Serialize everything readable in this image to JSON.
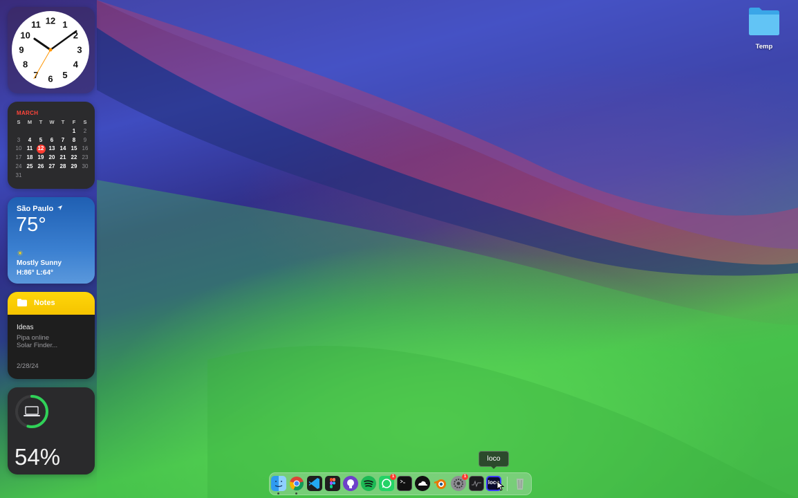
{
  "clock": {
    "numbers": [
      "12",
      "1",
      "2",
      "3",
      "4",
      "5",
      "6",
      "7",
      "8",
      "9",
      "10",
      "11"
    ],
    "hour": 10,
    "minute": 9,
    "second": 35,
    "second_hand_color": "#ff9500"
  },
  "calendar": {
    "month": "MARCH",
    "weekdays": [
      "S",
      "M",
      "T",
      "W",
      "T",
      "F",
      "S"
    ],
    "weeks": [
      [
        "",
        "",
        "",
        "",
        "",
        "1",
        "2"
      ],
      [
        "3",
        "4",
        "5",
        "6",
        "7",
        "8",
        "9"
      ],
      [
        "10",
        "11",
        "12",
        "13",
        "14",
        "15",
        "16"
      ],
      [
        "17",
        "18",
        "19",
        "20",
        "21",
        "22",
        "23"
      ],
      [
        "24",
        "25",
        "26",
        "27",
        "28",
        "29",
        "30"
      ],
      [
        "31",
        "",
        "",
        "",
        "",
        "",
        ""
      ]
    ],
    "today": "12",
    "accent": "#ff3b30"
  },
  "weather": {
    "city": "São Paulo",
    "location_icon": "location-arrow-icon",
    "temperature": "75°",
    "condition_icon": "sun-icon",
    "condition": "Mostly Sunny",
    "high_low": "H:86° L:64°"
  },
  "notes": {
    "header": "Notes",
    "header_icon": "folder-icon",
    "note_title": "Ideas",
    "lines": [
      "Pipa online",
      "Solar Finder..."
    ],
    "date": "2/28/24",
    "accent": "#ffd60a"
  },
  "battery": {
    "device_icon": "laptop-icon",
    "percent": "54%",
    "level": 0.54,
    "ring_color": "#30d158"
  },
  "desktop": {
    "folder_label": "Temp",
    "folder_icon": "folder-icon"
  },
  "dock": {
    "tooltip": "loco",
    "apps": [
      {
        "name": "finder",
        "icon": "finder-icon",
        "running": true,
        "badge": ""
      },
      {
        "name": "chrome",
        "icon": "chrome-icon",
        "running": true,
        "badge": ""
      },
      {
        "name": "vscode",
        "icon": "vscode-icon",
        "running": false,
        "badge": ""
      },
      {
        "name": "figma",
        "icon": "figma-icon",
        "running": false,
        "badge": ""
      },
      {
        "name": "github",
        "icon": "github-icon",
        "running": false,
        "badge": ""
      },
      {
        "name": "spotify",
        "icon": "spotify-icon",
        "running": false,
        "badge": ""
      },
      {
        "name": "whatsapp",
        "icon": "whatsapp-icon",
        "running": false,
        "badge": "1"
      },
      {
        "name": "terminal",
        "icon": "terminal-icon",
        "running": false,
        "badge": ""
      },
      {
        "name": "cloud-app",
        "icon": "cloud-app-icon",
        "running": false,
        "badge": ""
      },
      {
        "name": "blender",
        "icon": "blender-icon",
        "running": false,
        "badge": ""
      },
      {
        "name": "system-settings",
        "icon": "settings-gear-icon",
        "running": false,
        "badge": "1"
      },
      {
        "name": "activity-monitor",
        "icon": "activity-monitor-icon",
        "running": false,
        "badge": ""
      },
      {
        "name": "loco",
        "icon": "loco-icon",
        "running": false,
        "badge": "",
        "label": "loco"
      },
      {
        "name": "trash",
        "icon": "trash-icon",
        "running": false,
        "badge": ""
      }
    ]
  }
}
